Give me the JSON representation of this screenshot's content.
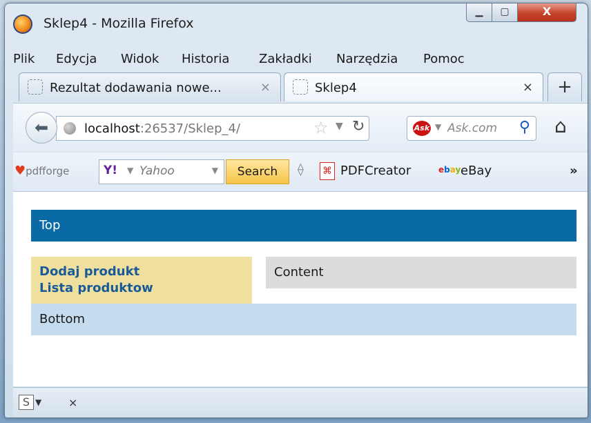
{
  "window": {
    "title": "Sklep4 - Mozilla Firefox",
    "btn_min": "▁",
    "btn_max": "▢",
    "btn_close": "X"
  },
  "menu": {
    "items": [
      "Plik",
      "Edycja",
      "Widok",
      "Historia",
      "Zakładki",
      "Narzędzia",
      "Pomoc"
    ]
  },
  "tabs": [
    {
      "label": "Rezultat dodawania nowe...",
      "close": "×"
    },
    {
      "label": "Sklep4",
      "close": "×"
    }
  ],
  "new_tab": "+",
  "nav": {
    "url_host": "localhost",
    "url_rest": ":26537/Sklep_4/",
    "search_engine": "Ask",
    "search_placeholder": "Ask.com"
  },
  "bookmarks": {
    "pdfforge_label": "pdfforge",
    "yahoo_logo": "Y!",
    "yahoo_placeholder": "Yahoo",
    "search_button": "Search",
    "pdfcreator_label": "PDFCreator",
    "ebay_label": "eBay",
    "more": "»"
  },
  "page": {
    "top": "Top",
    "links": [
      "Dodaj produkt",
      "Lista produktow"
    ],
    "content": "Content",
    "bottom": "Bottom"
  },
  "status": {
    "close": "×"
  },
  "colors": {
    "top_bar": "#0a6aa6",
    "left_col": "#efe0a0",
    "content_col": "#dcdcdc",
    "bottom_bar": "#c4dcee",
    "link": "#1a5a96"
  }
}
